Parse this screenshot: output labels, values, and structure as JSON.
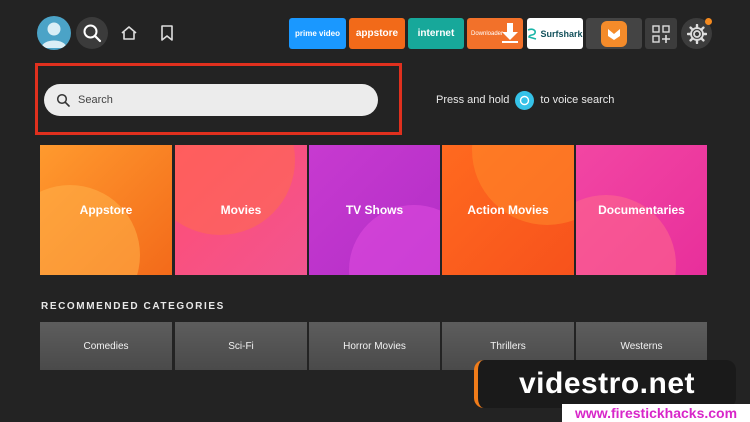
{
  "topbar": {
    "apps": [
      {
        "label": "prime video",
        "color": "#1a98ff"
      },
      {
        "label": "appstore",
        "color": "#f26a19"
      },
      {
        "label": "internet",
        "color": "#17a89a"
      },
      {
        "label": "Downloader",
        "color": "#f2712a"
      },
      {
        "label": "Surfshark",
        "color": "#ffffff"
      },
      {
        "label": "",
        "color": "#444444"
      }
    ]
  },
  "search": {
    "placeholder": "Search",
    "voice_hint_pre": "Press and hold",
    "voice_hint_post": "to voice search"
  },
  "categories": [
    {
      "label": "Appstore",
      "from": "#ff9a2e",
      "to": "#f36a1a"
    },
    {
      "label": "Movies",
      "from": "#ff4d73",
      "to": "#f2558f"
    },
    {
      "label": "TV Shows",
      "from": "#c73ad0",
      "to": "#b32ec7"
    },
    {
      "label": "Action Movies",
      "from": "#ff6a1f",
      "to": "#f7521c"
    },
    {
      "label": "Documentaries",
      "from": "#f246a3",
      "to": "#e82f9b"
    }
  ],
  "recommended": {
    "heading": "RECOMMENDED CATEGORIES",
    "items": [
      "Comedies",
      "Sci-Fi",
      "Horror Movies",
      "Thrillers",
      "Westerns"
    ]
  },
  "watermark": {
    "main": "videstro.net",
    "strip": "www.firestickhacks.com"
  },
  "colors": {
    "highlight": "#e0301e",
    "background": "#232323",
    "mic": "#35c2e8"
  }
}
